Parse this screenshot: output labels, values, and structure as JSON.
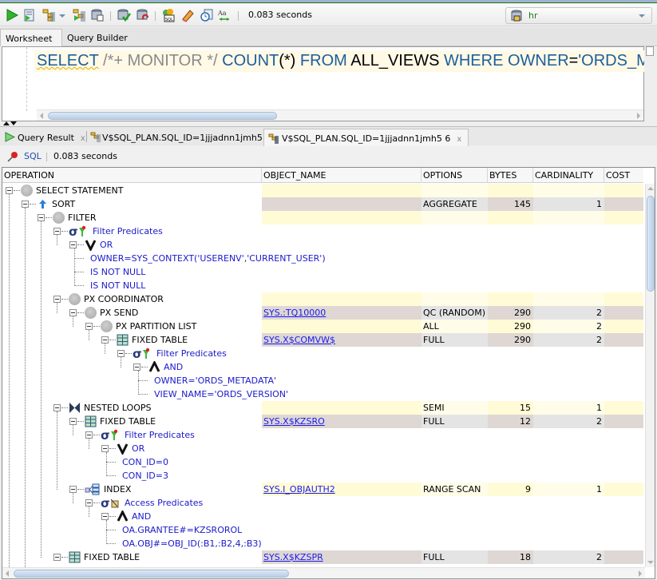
{
  "toolbar": {
    "icons": [
      "run-statement-icon",
      "run-script-icon",
      "explain-plan-icon",
      "explain-plan-dropdown-icon",
      "autotrace-icon",
      "sql-tuning-advisor-icon",
      "commit-icon",
      "rollback-icon",
      "unshared-sql-worksheet-icon",
      "clear-icon",
      "sql-history-icon",
      "format-case-icon"
    ],
    "elapsed": "0.083 seconds",
    "connection": {
      "label": "hr",
      "icon": "database-connection-icon"
    }
  },
  "worksheet_tabs": [
    {
      "label": "Worksheet",
      "active": true
    },
    {
      "label": "Query Builder",
      "active": false
    }
  ],
  "editor": {
    "tokens": [
      {
        "text": "SELECT",
        "type": "keyword"
      },
      {
        "text": " /*+ MONITOR */ ",
        "type": "comment"
      },
      {
        "text": "COUNT",
        "type": "keyword"
      },
      {
        "text": "(*) ",
        "type": "plain"
      },
      {
        "text": "FROM",
        "type": "keyword"
      },
      {
        "text": " ALL_VIEWS ",
        "type": "plain"
      },
      {
        "text": "WHERE",
        "type": "keyword"
      },
      {
        "text": " ",
        "type": "plain"
      },
      {
        "text": "OWNER",
        "type": "keyword"
      },
      {
        "text": "=",
        "type": "plain"
      },
      {
        "text": "'ORDS_METADATA'",
        "type": "string"
      }
    ]
  },
  "result_tabs": [
    {
      "label": "Query Result",
      "close": "x",
      "icon": "run-icon",
      "active": false
    },
    {
      "label": "V$SQL_PLAN.SQL_ID=1jjjadnn1jmh5",
      "close": "x",
      "icon": "explain-plan-icon",
      "active": false
    },
    {
      "label": "V$SQL_PLAN.SQL_ID=1jjjadnn1jmh5 6",
      "close": "x",
      "icon": "explain-plan-icon",
      "active": true
    }
  ],
  "result_bar": {
    "sql_label": "SQL",
    "elapsed": "0.083 seconds"
  },
  "grid": {
    "columns": [
      "OPERATION",
      "OBJECT_NAME",
      "OPTIONS",
      "BYTES",
      "CARDINALITY",
      "COST"
    ],
    "rows": [
      {
        "depth": 0,
        "icon": "circle",
        "label": "SELECT STATEMENT",
        "kind": "op",
        "band": "a",
        "object": "",
        "options": "",
        "bytes": "",
        "cardinality": "",
        "cost": ""
      },
      {
        "depth": 1,
        "icon": "sort",
        "label": "SORT",
        "kind": "op",
        "band": "b",
        "object": "",
        "options": "AGGREGATE",
        "bytes": "145",
        "cardinality": "1",
        "cost": ""
      },
      {
        "depth": 2,
        "icon": "circle",
        "label": "FILTER",
        "kind": "op",
        "band": "a",
        "object": "",
        "options": "",
        "bytes": "",
        "cardinality": "",
        "cost": ""
      },
      {
        "depth": 3,
        "icon": "filter",
        "label": "Filter Predicates",
        "kind": "pred",
        "band": "",
        "object": "",
        "options": "",
        "bytes": "",
        "cardinality": "",
        "cost": ""
      },
      {
        "depth": 4,
        "icon": "or",
        "label": "OR",
        "kind": "pred",
        "band": "",
        "object": "",
        "options": "",
        "bytes": "",
        "cardinality": "",
        "cost": ""
      },
      {
        "depth": 5,
        "icon": "",
        "label": "OWNER=SYS_CONTEXT('USERENV','CURRENT_USER')",
        "kind": "leaf",
        "band": "",
        "object": "",
        "options": "",
        "bytes": "",
        "cardinality": "",
        "cost": ""
      },
      {
        "depth": 5,
        "icon": "",
        "label": "IS NOT NULL",
        "kind": "leaf",
        "band": "",
        "object": "",
        "options": "",
        "bytes": "",
        "cardinality": "",
        "cost": ""
      },
      {
        "depth": 5,
        "icon": "",
        "label": "IS NOT NULL",
        "kind": "leaf",
        "band": "",
        "object": "",
        "options": "",
        "bytes": "",
        "cardinality": "",
        "cost": ""
      },
      {
        "depth": 3,
        "icon": "circle",
        "label": "PX COORDINATOR",
        "kind": "op",
        "band": "a",
        "object": "",
        "options": "",
        "bytes": "",
        "cardinality": "",
        "cost": ""
      },
      {
        "depth": 4,
        "icon": "circle",
        "label": "PX SEND",
        "kind": "op",
        "band": "b",
        "object": "SYS.:TQ10000",
        "options": "QC (RANDOM)",
        "bytes": "290",
        "cardinality": "2",
        "cost": ""
      },
      {
        "depth": 5,
        "icon": "circle",
        "label": "PX PARTITION LIST",
        "kind": "op",
        "band": "a",
        "object": "",
        "options": "ALL",
        "bytes": "290",
        "cardinality": "2",
        "cost": ""
      },
      {
        "depth": 6,
        "icon": "table",
        "label": "FIXED TABLE",
        "kind": "op",
        "band": "b",
        "object": "SYS.X$COMVW$",
        "options": "FULL",
        "bytes": "290",
        "cardinality": "2",
        "cost": ""
      },
      {
        "depth": 7,
        "icon": "filter",
        "label": "Filter Predicates",
        "kind": "pred",
        "band": "",
        "object": "",
        "options": "",
        "bytes": "",
        "cardinality": "",
        "cost": ""
      },
      {
        "depth": 8,
        "icon": "and",
        "label": "AND",
        "kind": "pred",
        "band": "",
        "object": "",
        "options": "",
        "bytes": "",
        "cardinality": "",
        "cost": ""
      },
      {
        "depth": 9,
        "icon": "",
        "label": "OWNER='ORDS_METADATA'",
        "kind": "leaf",
        "band": "",
        "object": "",
        "options": "",
        "bytes": "",
        "cardinality": "",
        "cost": ""
      },
      {
        "depth": 9,
        "icon": "",
        "label": "VIEW_NAME='ORDS_VERSION'",
        "kind": "leaf",
        "band": "",
        "object": "",
        "options": "",
        "bytes": "",
        "cardinality": "",
        "cost": ""
      },
      {
        "depth": 3,
        "icon": "nested",
        "label": "NESTED LOOPS",
        "kind": "op",
        "band": "a",
        "object": "",
        "options": "SEMI",
        "bytes": "15",
        "cardinality": "1",
        "cost": ""
      },
      {
        "depth": 4,
        "icon": "table",
        "label": "FIXED TABLE",
        "kind": "op",
        "band": "b",
        "object": "SYS.X$KZSRO",
        "options": "FULL",
        "bytes": "12",
        "cardinality": "2",
        "cost": ""
      },
      {
        "depth": 5,
        "icon": "filter",
        "label": "Filter Predicates",
        "kind": "pred",
        "band": "",
        "object": "",
        "options": "",
        "bytes": "",
        "cardinality": "",
        "cost": ""
      },
      {
        "depth": 6,
        "icon": "or",
        "label": "OR",
        "kind": "pred",
        "band": "",
        "object": "",
        "options": "",
        "bytes": "",
        "cardinality": "",
        "cost": ""
      },
      {
        "depth": 7,
        "icon": "",
        "label": "CON_ID=0",
        "kind": "leaf",
        "band": "",
        "object": "",
        "options": "",
        "bytes": "",
        "cardinality": "",
        "cost": ""
      },
      {
        "depth": 7,
        "icon": "",
        "label": "CON_ID=3",
        "kind": "leaf",
        "band": "",
        "object": "",
        "options": "",
        "bytes": "",
        "cardinality": "",
        "cost": ""
      },
      {
        "depth": 4,
        "icon": "index",
        "label": "INDEX",
        "kind": "op",
        "band": "a",
        "object": "SYS.I_OBJAUTH2",
        "options": "RANGE SCAN",
        "bytes": "9",
        "cardinality": "1",
        "cost": ""
      },
      {
        "depth": 5,
        "icon": "access",
        "label": "Access Predicates",
        "kind": "pred",
        "band": "",
        "object": "",
        "options": "",
        "bytes": "",
        "cardinality": "",
        "cost": ""
      },
      {
        "depth": 6,
        "icon": "and",
        "label": "AND",
        "kind": "pred",
        "band": "",
        "object": "",
        "options": "",
        "bytes": "",
        "cardinality": "",
        "cost": ""
      },
      {
        "depth": 7,
        "icon": "",
        "label": "OA.GRANTEE#=KZSROROL",
        "kind": "leaf",
        "band": "",
        "object": "",
        "options": "",
        "bytes": "",
        "cardinality": "",
        "cost": ""
      },
      {
        "depth": 7,
        "icon": "",
        "label": "OA.OBJ#=OBJ_ID(:B1,:B2,4,:B3)",
        "kind": "leaf",
        "band": "",
        "object": "",
        "options": "",
        "bytes": "",
        "cardinality": "",
        "cost": ""
      },
      {
        "depth": 3,
        "icon": "table",
        "label": "FIXED TABLE",
        "kind": "op",
        "band": "b",
        "object": "SYS.X$KZSPR",
        "options": "FULL",
        "bytes": "18",
        "cardinality": "2",
        "cost": ""
      }
    ]
  }
}
